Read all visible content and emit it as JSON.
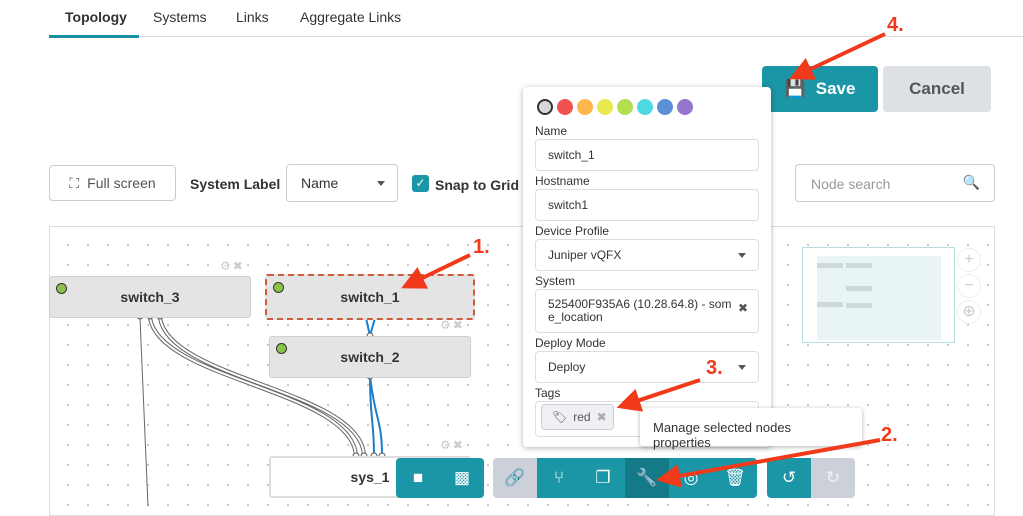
{
  "tabs": [
    "Topology",
    "Systems",
    "Links",
    "Aggregate Links"
  ],
  "header": {
    "save": "Save",
    "cancel": "Cancel"
  },
  "toolbar": {
    "fullscreen": "Full screen",
    "system_label": "System Label",
    "system_label_value": "Name",
    "snap": "Snap to Grid",
    "search_placeholder": "Node search"
  },
  "nodes": [
    "switch_3",
    "switch_1",
    "switch_2",
    "sys_1"
  ],
  "popup": {
    "colors": [
      "#d8d8d8",
      "#ef5350",
      "#ffb74d",
      "#e8e84f",
      "#b2de4f",
      "#4dd9df",
      "#5b8fd6",
      "#9575cd"
    ],
    "name_label": "Name",
    "name": "switch_1",
    "hostname_label": "Hostname",
    "hostname": "switch1",
    "profile_label": "Device Profile",
    "profile": "Juniper vQFX",
    "system_label": "System",
    "system": "525400F935A6 (10.28.64.8) - some_location",
    "deploy_label": "Deploy Mode",
    "deploy": "Deploy",
    "tags_label": "Tags",
    "tag": "red"
  },
  "tooltip": "Manage selected nodes properties",
  "annotations": [
    "1.",
    "2.",
    "3.",
    "4."
  ],
  "accent": "#1a96a6"
}
